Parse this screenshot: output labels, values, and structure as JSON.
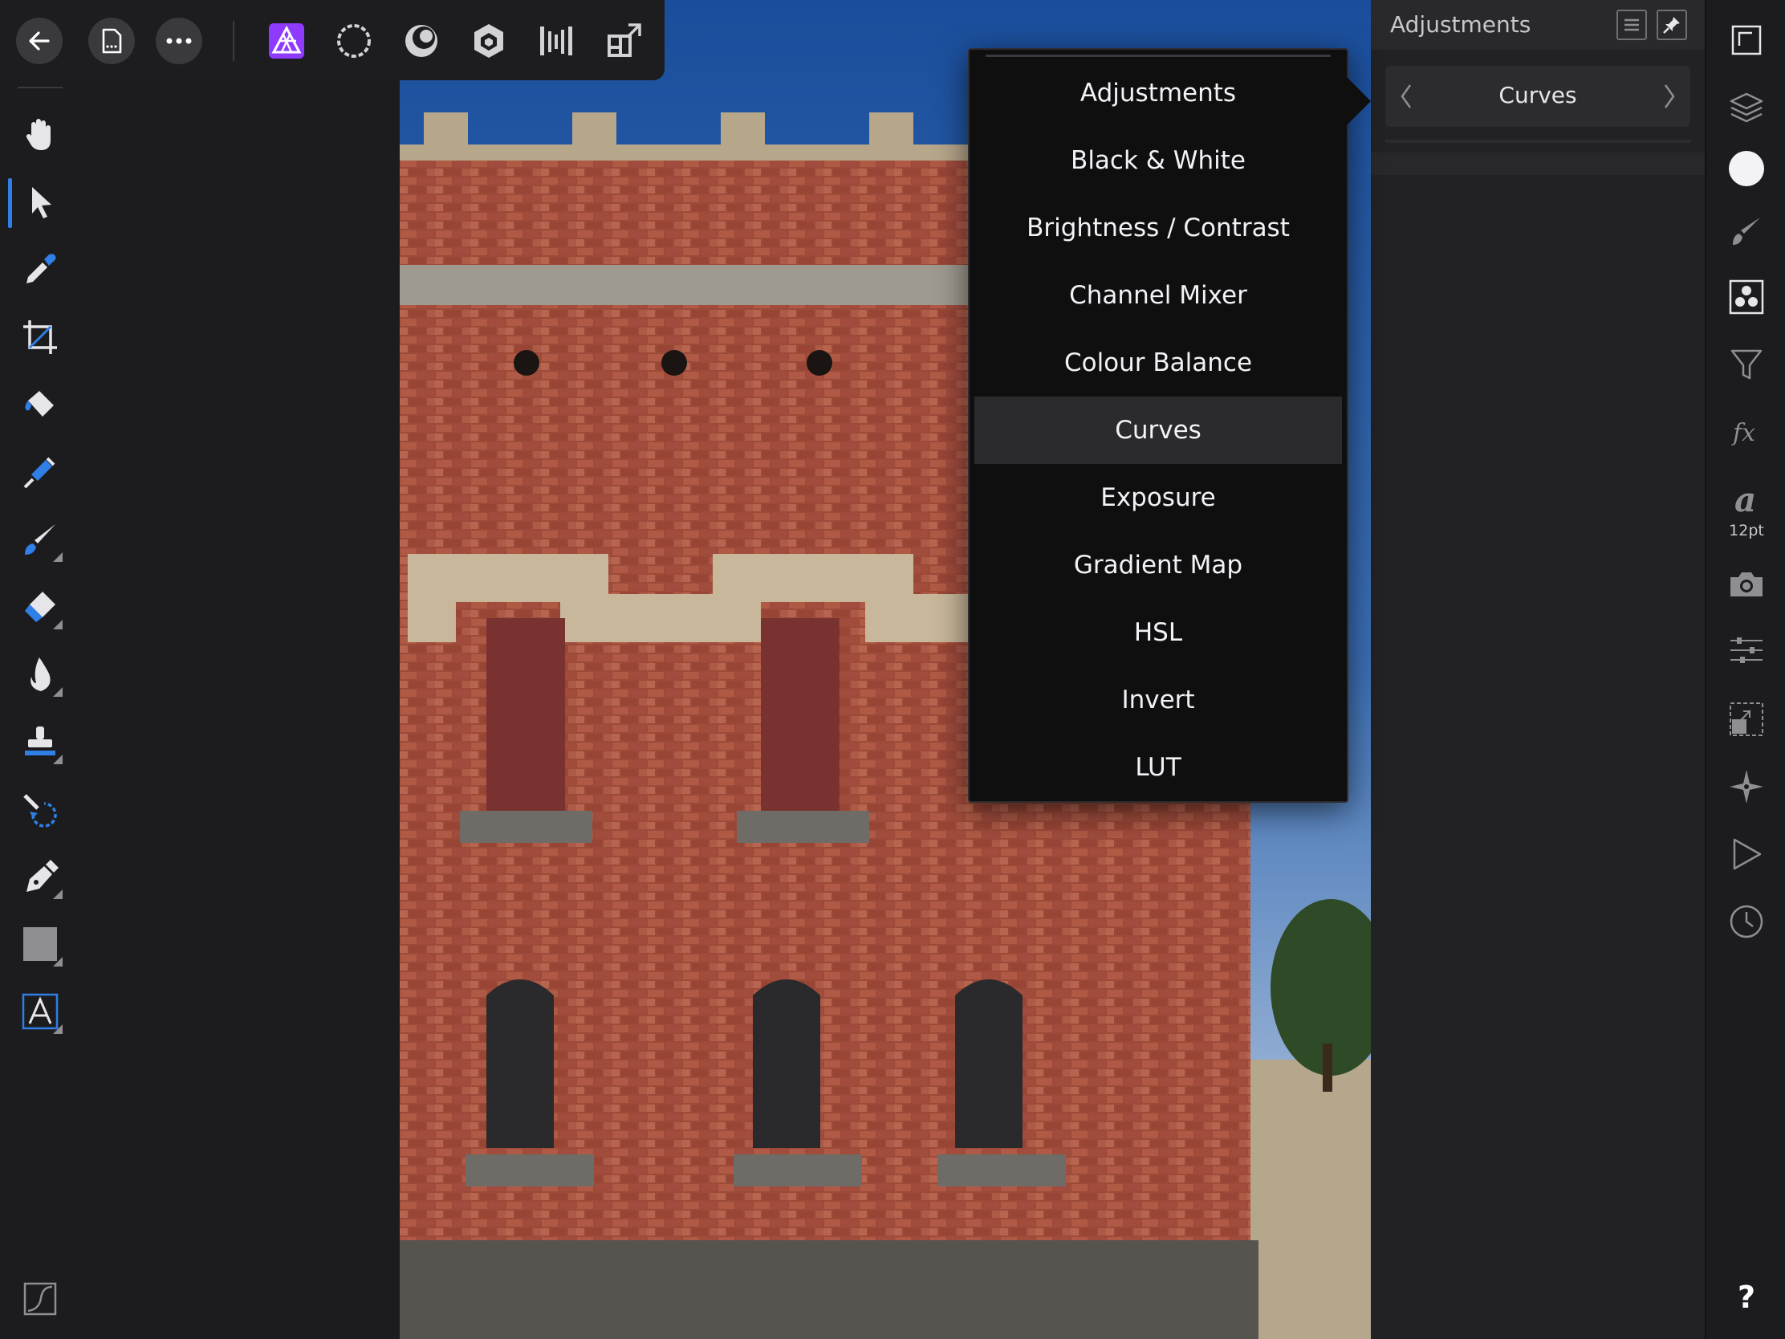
{
  "toolbar": {
    "buttons": [
      "back-arrow-icon",
      "document-icon",
      "more-icon"
    ],
    "personas": [
      "photo-persona-icon",
      "liquify-persona-icon",
      "develop-persona-icon",
      "tone-mapping-persona-icon",
      "export-persona-icon",
      "macro-persona-icon"
    ],
    "accent_color": "#8e3bff"
  },
  "tools": [
    {
      "name": "hand-tool-icon"
    },
    {
      "name": "move-tool-icon",
      "active": true
    },
    {
      "name": "color-picker-tool-icon"
    },
    {
      "name": "crop-tool-icon"
    },
    {
      "name": "flood-fill-tool-icon"
    },
    {
      "name": "selection-brush-tool-icon"
    },
    {
      "name": "paint-brush-tool-icon"
    },
    {
      "name": "erase-brush-tool-icon"
    },
    {
      "name": "burn-brush-tool-icon"
    },
    {
      "name": "clone-brush-tool-icon"
    },
    {
      "name": "undo-brush-tool-icon"
    },
    {
      "name": "pen-tool-icon"
    },
    {
      "name": "rectangle-tool-icon"
    },
    {
      "name": "artistic-text-tool-icon"
    }
  ],
  "adjustments_panel": {
    "title": "Adjustments",
    "selected": "Curves"
  },
  "menu": {
    "items": [
      "Adjustments",
      "Black & White",
      "Brightness / Contrast",
      "Channel Mixer",
      "Colour Balance",
      "Curves",
      "Exposure",
      "Gradient Map",
      "HSL",
      "Invert",
      "LUT"
    ],
    "selected_index": 5
  },
  "right_panel": {
    "icons": [
      "canvas-size-icon",
      "layers-icon",
      "colour-icon",
      "brush-icon",
      "adjustments-icon",
      "filters-icon",
      "effects-icon",
      "character-icon",
      "snapshot-icon",
      "transform-icon",
      "selection-icon",
      "navigator-icon",
      "macro-icon",
      "history-icon"
    ],
    "font_size_label": "12pt",
    "help_label": "?"
  },
  "colors": {
    "accent": "#2f7fe6",
    "menu_bg": "#0f0f10",
    "panel_bg": "#222224"
  }
}
